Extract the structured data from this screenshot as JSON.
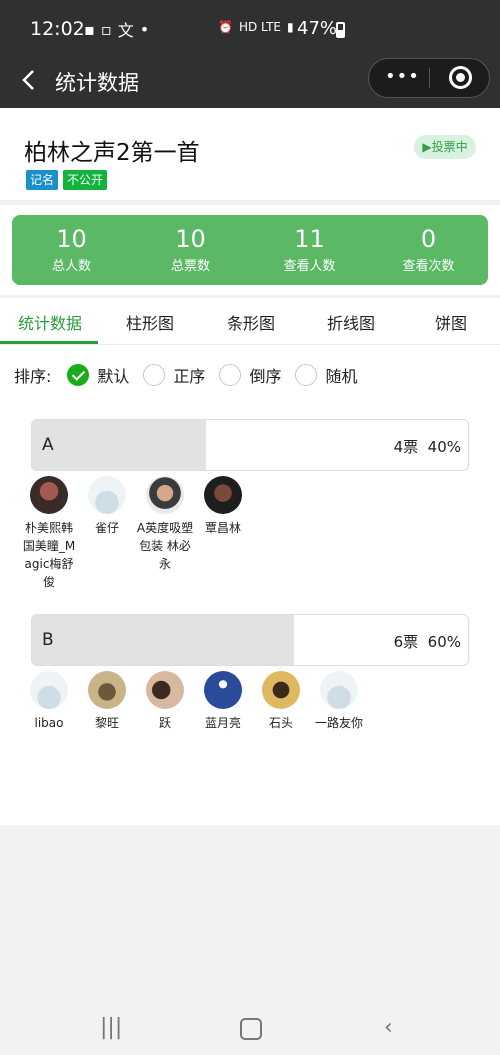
{
  "status_bar": {
    "time": "12:02",
    "network": "HD LTE",
    "battery": "47%"
  },
  "nav": {
    "title": "统计数据"
  },
  "poll": {
    "title": "柏林之声2第一首",
    "tags": [
      "记名",
      "不公开"
    ],
    "status": "▶投票中"
  },
  "stats": [
    {
      "value": "10",
      "label": "总人数"
    },
    {
      "value": "10",
      "label": "总票数"
    },
    {
      "value": "11",
      "label": "查看人数"
    },
    {
      "value": "0",
      "label": "查看次数"
    }
  ],
  "tabs": [
    "统计数据",
    "柱形图",
    "条形图",
    "折线图",
    "饼图"
  ],
  "active_tab": 0,
  "sort": {
    "label": "排序:",
    "options": [
      "默认",
      "正序",
      "倒序",
      "随机"
    ],
    "selected": 0
  },
  "options": [
    {
      "name": "A",
      "votes_text": "4票",
      "percent_text": "40%",
      "percent": 40,
      "voters": [
        "朴美熙韩国美瞳_Magic梅舒俊",
        "雀仔",
        "A英度吸塑包装 林必永",
        "覃昌林"
      ]
    },
    {
      "name": "B",
      "votes_text": "6票",
      "percent_text": "60%",
      "percent": 60,
      "voters": [
        "libao",
        "黎旺",
        "跃",
        "蓝月亮",
        "石头",
        "一路友你"
      ]
    }
  ]
}
